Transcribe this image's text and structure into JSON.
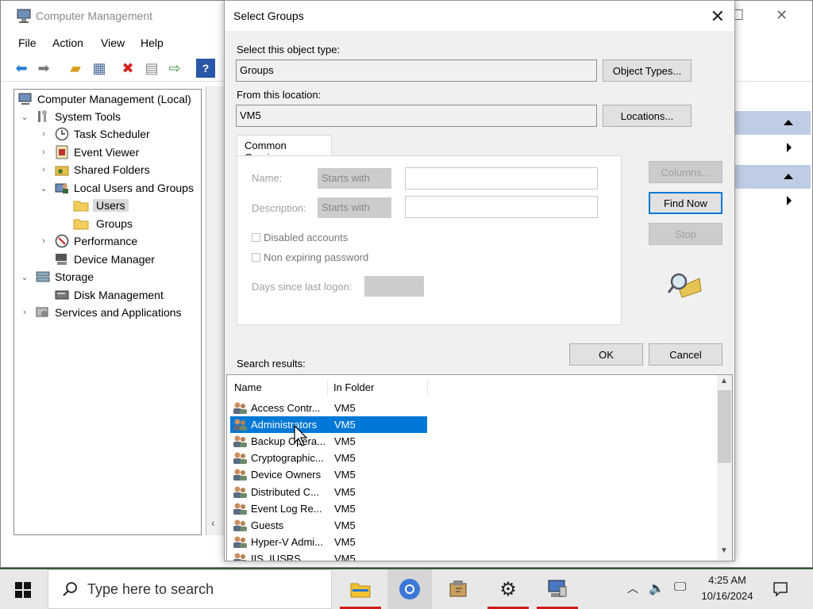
{
  "main_window": {
    "title": "Computer Management",
    "menu": [
      "File",
      "Action",
      "View",
      "Help"
    ],
    "tree": [
      {
        "label": "Computer Management (Local)",
        "icon": "computer-icon"
      },
      {
        "label": "System Tools",
        "icon": "tools-icon",
        "expanded": true
      },
      {
        "label": "Task Scheduler",
        "icon": "clock-icon"
      },
      {
        "label": "Event Viewer",
        "icon": "event-viewer-icon"
      },
      {
        "label": "Shared Folders",
        "icon": "shared-folder-icon"
      },
      {
        "label": "Local Users and Groups",
        "icon": "users-icon",
        "expanded": true
      },
      {
        "label": "Users",
        "icon": "folder-icon",
        "selected": true
      },
      {
        "label": "Groups",
        "icon": "folder-icon"
      },
      {
        "label": "Performance",
        "icon": "performance-icon"
      },
      {
        "label": "Device Manager",
        "icon": "device-manager-icon"
      },
      {
        "label": "Storage",
        "icon": "storage-icon",
        "expanded": true
      },
      {
        "label": "Disk Management",
        "icon": "disk-icon"
      },
      {
        "label": "Services and Applications",
        "icon": "services-icon"
      }
    ]
  },
  "dialog": {
    "title": "Select Groups",
    "object_type_label": "Select this object type:",
    "object_type_value": "Groups",
    "object_types_button": "Object Types...",
    "location_label": "From this location:",
    "location_value": "VM5",
    "locations_button": "Locations...",
    "common_queries_tab": "Common Queries",
    "name_label": "Name:",
    "name_mode": "Starts with",
    "description_label": "Description:",
    "description_mode": "Starts with",
    "disabled_accounts": "Disabled accounts",
    "non_expiring_password": "Non expiring password",
    "days_since_logon": "Days since last logon:",
    "columns_button": "Columns...",
    "find_now_button": "Find Now",
    "stop_button": "Stop",
    "ok_button": "OK",
    "cancel_button": "Cancel",
    "search_results_label": "Search results:",
    "results_columns": [
      "Name",
      "In Folder"
    ],
    "results": [
      {
        "name": "Access Contr...",
        "folder": "VM5"
      },
      {
        "name": "Administrators",
        "folder": "VM5",
        "selected": true
      },
      {
        "name": "Backup Opera...",
        "folder": "VM5"
      },
      {
        "name": "Cryptographic...",
        "folder": "VM5"
      },
      {
        "name": "Device Owners",
        "folder": "VM5"
      },
      {
        "name": "Distributed C...",
        "folder": "VM5"
      },
      {
        "name": "Event Log Re...",
        "folder": "VM5"
      },
      {
        "name": "Guests",
        "folder": "VM5"
      },
      {
        "name": "Hyper-V Admi...",
        "folder": "VM5"
      },
      {
        "name": "IIS_IUSRS",
        "folder": "VM5"
      }
    ]
  },
  "taskbar": {
    "search_placeholder": "Type here to search",
    "time": "4:25 AM",
    "date": "10/16/2024"
  },
  "colors": {
    "selection": "#0078d7",
    "actions_header": "#bfcde4",
    "taskbar_indicator": "#d11a1a"
  }
}
